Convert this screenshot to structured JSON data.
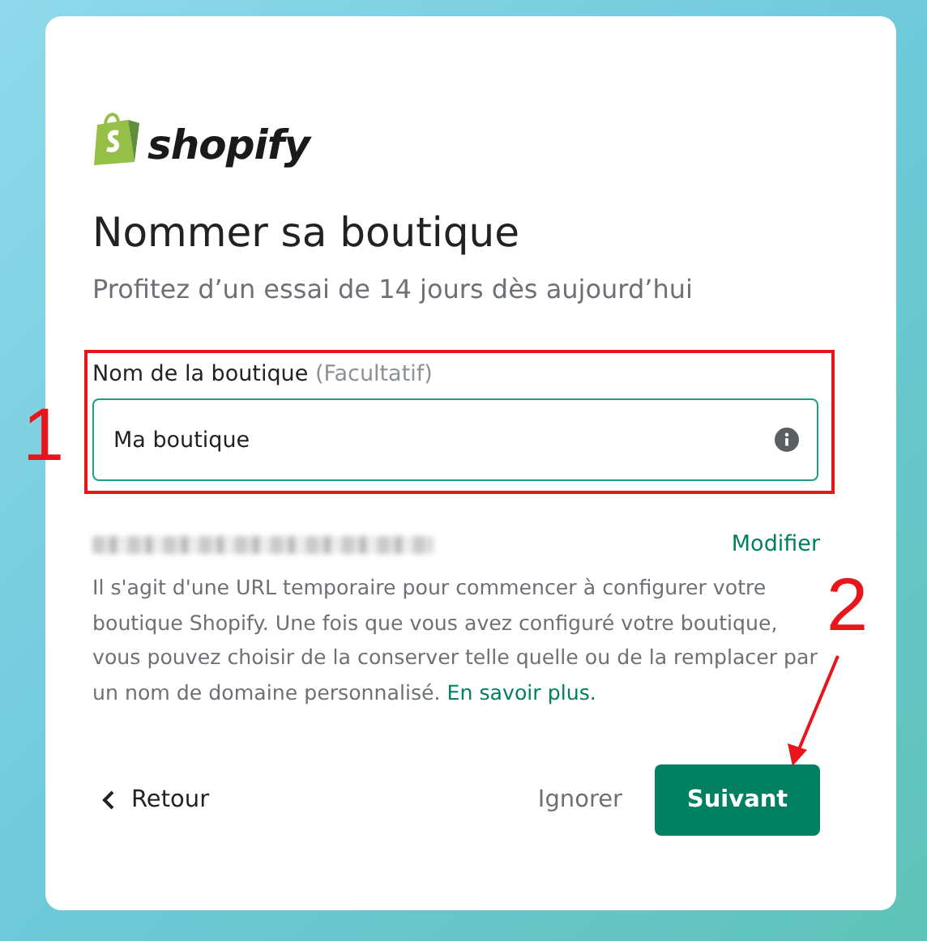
{
  "logo": {
    "wordmark": "shopify"
  },
  "heading": "Nommer sa boutique",
  "subtitle": "Profitez d’un essai de 14 jours dès aujourd’hui",
  "store_name": {
    "label": "Nom de la boutique",
    "optional": "(Facultatif)",
    "value": "Ma boutique"
  },
  "url": {
    "action": "Modifier"
  },
  "description": {
    "text": "Il s'agit d'une URL temporaire pour commencer à configurer votre boutique Shopify. Une fois que vous avez configuré votre boutique, vous pouvez choisir de la conserver telle quelle ou de la remplacer par un nom de domaine personnalisé.",
    "link": "En savoir plus."
  },
  "buttons": {
    "back": "Retour",
    "skip": "Ignorer",
    "next": "Suivant"
  },
  "annotations": [
    {
      "number": "1"
    },
    {
      "number": "2"
    }
  ]
}
